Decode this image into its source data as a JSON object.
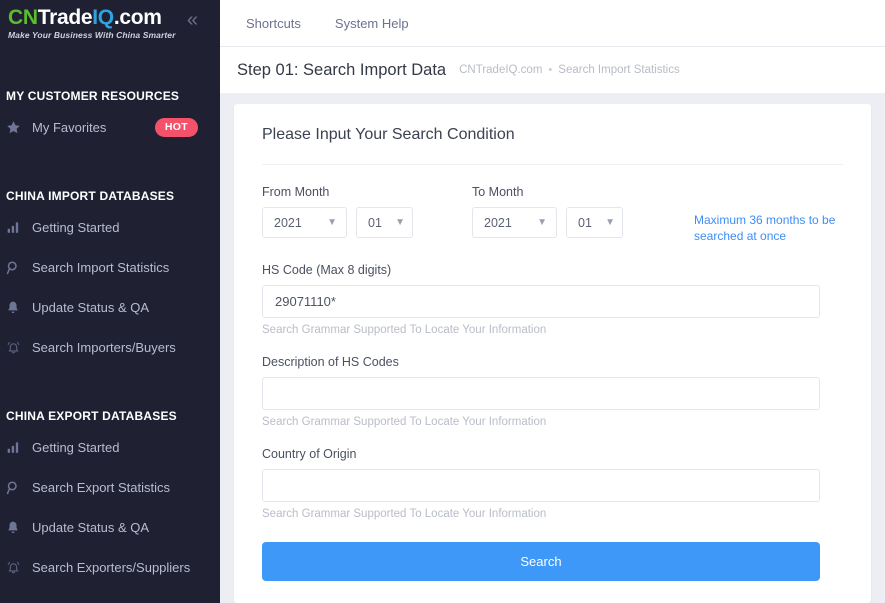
{
  "sidebar": {
    "brand": {
      "cn": "CN",
      "trade": "Trade",
      "iq": "IQ",
      "com": ".com",
      "tagline": "Make Your Business With China Smarter"
    },
    "collapse_icon": "double-chevron-left",
    "sections": [
      {
        "title": "MY CUSTOMER RESOURCES",
        "items": [
          {
            "label": "My Favorites",
            "icon": "star-icon",
            "badge": "HOT"
          }
        ]
      },
      {
        "title": "CHINA IMPORT DATABASES",
        "items": [
          {
            "label": "Getting Started",
            "icon": "bar-chart-icon",
            "badge": ""
          },
          {
            "label": "Search Import Statistics",
            "icon": "search-icon",
            "badge": ""
          },
          {
            "label": "Update Status & QA",
            "icon": "bell-filled-icon",
            "badge": ""
          },
          {
            "label": "Search Importers/Buyers",
            "icon": "bell-ring-icon",
            "badge": ""
          }
        ]
      },
      {
        "title": "CHINA EXPORT DATABASES",
        "items": [
          {
            "label": "Getting Started",
            "icon": "bar-chart-icon",
            "badge": ""
          },
          {
            "label": "Search Export Statistics",
            "icon": "search-icon",
            "badge": ""
          },
          {
            "label": "Update Status & QA",
            "icon": "bell-filled-icon",
            "badge": ""
          },
          {
            "label": "Search Exporters/Suppliers",
            "icon": "bell-ring-icon",
            "badge": ""
          }
        ]
      }
    ]
  },
  "topnav": {
    "items": [
      {
        "label": "Shortcuts"
      },
      {
        "label": "System Help"
      }
    ]
  },
  "pagehead": {
    "title": "Step 01: Search Import Data",
    "breadcrumb": {
      "root": "CNTradeIQ.com",
      "separator": "•",
      "current": "Search Import Statistics"
    }
  },
  "form": {
    "card_title": "Please Input Your Search Condition",
    "from_month": {
      "label": "From Month",
      "year": "2021",
      "month": "01"
    },
    "to_month": {
      "label": "To Month",
      "year": "2021",
      "month": "01"
    },
    "max_months_note": "Maximum 36 months to be searched at once",
    "hs_code": {
      "label": "HS Code (Max 8 digits)",
      "value": "29071110*",
      "placeholder": "",
      "hint": "Search Grammar Supported To Locate Your Information"
    },
    "description": {
      "label": "Description of HS Codes",
      "value": "",
      "placeholder": "",
      "hint": "Search Grammar Supported To Locate Your Information"
    },
    "country": {
      "label": "Country of Origin",
      "value": "",
      "placeholder": "",
      "hint": "Search Grammar Supported To Locate Your Information"
    },
    "search_button": "Search"
  },
  "colors": {
    "sidebar_bg": "#1f2133",
    "accent_blue": "#3d98f7",
    "badge_red": "#f4526a",
    "brand_green": "#5bbd2d",
    "brand_blue": "#2fa3e0"
  }
}
